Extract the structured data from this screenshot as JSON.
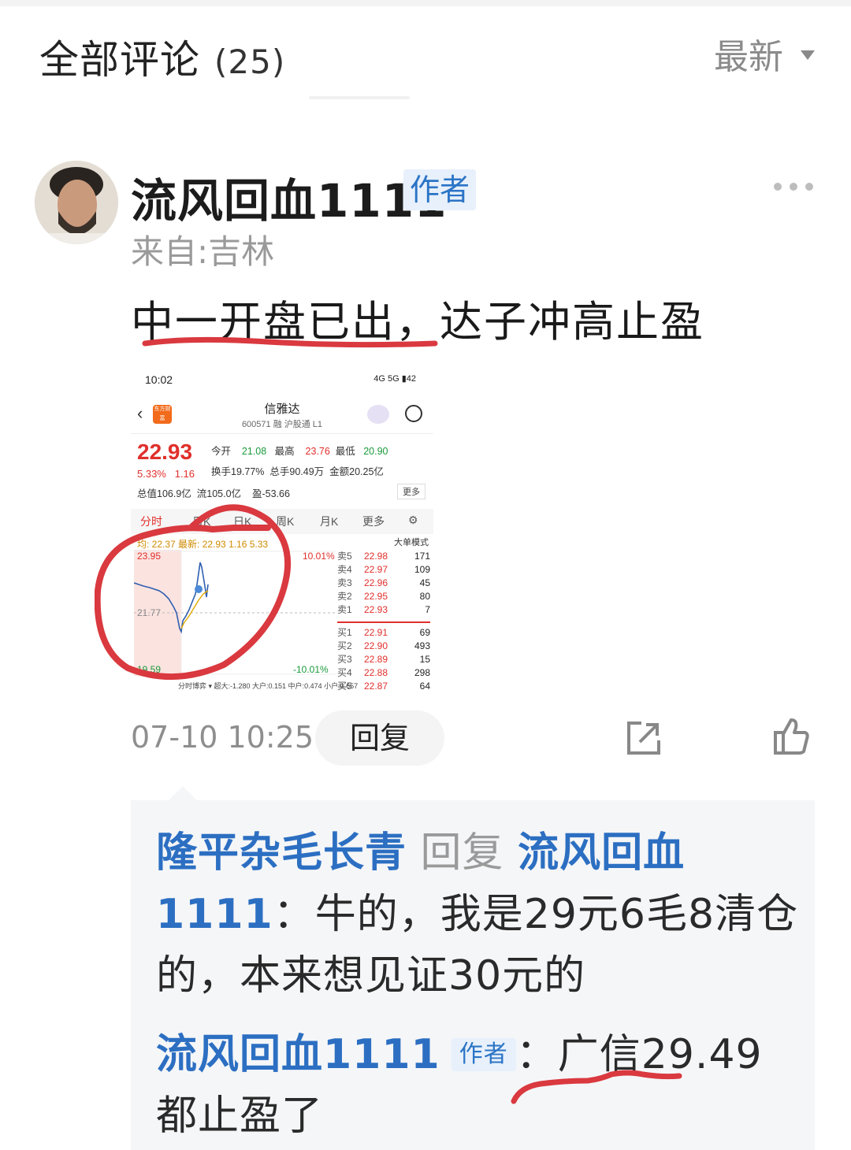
{
  "header": {
    "title": "全部评论",
    "count": "(25)",
    "sort_label": "最新"
  },
  "comment": {
    "username": "流风回血1111",
    "badge": "作者",
    "location": "来自:吉林",
    "text": "中一开盘已出，达子冲高止盈",
    "time": "07-10 10:25",
    "reply_label": "回复",
    "icons": [
      "more-icon",
      "share-icon",
      "like-icon"
    ]
  },
  "stock_screenshot": {
    "status_time": "10:02",
    "status_right": "4G 5G ▮42",
    "app_badge": "东方财富",
    "name": "信雅达",
    "code": "600571 融 沪股通 L1",
    "price": "22.93",
    "change_pct": "5.33%",
    "change_abs": "1.16",
    "row1": {
      "open_label": "今开",
      "open": "21.08",
      "high_label": "最高",
      "high": "23.76",
      "low_label": "最低",
      "low": "20.90"
    },
    "row2": {
      "turnover_label": "换手",
      "turnover": "19.77%",
      "volume_label": "总手",
      "volume": "90.49万",
      "amount_label": "金额",
      "amount": "20.25亿"
    },
    "row3": {
      "mktcap_label": "总值",
      "mktcap": "106.9亿",
      "float_label": "流",
      "float": "105.0亿",
      "pe_label": "盈",
      "pe": "-53.66"
    },
    "more_label": "更多",
    "tabs": [
      "分时",
      "日K",
      "日K",
      "周K",
      "月K",
      "更多"
    ],
    "chart_info": "均: 22.37 最新: 22.93 1.16 5.33",
    "mode_label": "大单模式",
    "y_top": "23.95",
    "y_mid": "21.77",
    "y_bottom": "19.59",
    "pct_top": "10.01%",
    "pct_bottom": "-10.01%",
    "sells": [
      {
        "label": "卖5",
        "price": "22.98",
        "vol": "171"
      },
      {
        "label": "卖4",
        "price": "22.97",
        "vol": "109"
      },
      {
        "label": "卖3",
        "price": "22.96",
        "vol": "45"
      },
      {
        "label": "卖2",
        "price": "22.95",
        "vol": "80"
      },
      {
        "label": "卖1",
        "price": "22.93",
        "vol": "7"
      }
    ],
    "buys": [
      {
        "label": "买1",
        "price": "22.91",
        "vol": "69"
      },
      {
        "label": "买2",
        "price": "22.90",
        "vol": "493"
      },
      {
        "label": "买3",
        "price": "22.89",
        "vol": "15"
      },
      {
        "label": "买4",
        "price": "22.88",
        "vol": "298"
      },
      {
        "label": "买5",
        "price": "22.87",
        "vol": "64"
      }
    ],
    "footer": "分时博弈 ▾ 超大:-1.280 大户:0.151 中户:0.474 小户:0.657"
  },
  "replies": [
    {
      "from": "隆平杂毛长青",
      "action": "回复",
      "to": "流风回血1111",
      "sep": "：",
      "text": "牛的，我是29元6毛8清仓的，本来想见证30元的"
    },
    {
      "from": "流风回血1111",
      "badge": "作者",
      "sep": "：",
      "text": "广信29.49都止盈了"
    }
  ],
  "colors": {
    "accent_blue": "#2c6fc2",
    "badge_bg": "#e7f0fb",
    "stock_red": "#e0302c",
    "stock_green": "#1a9a3a",
    "mark_red": "#d9393f"
  }
}
